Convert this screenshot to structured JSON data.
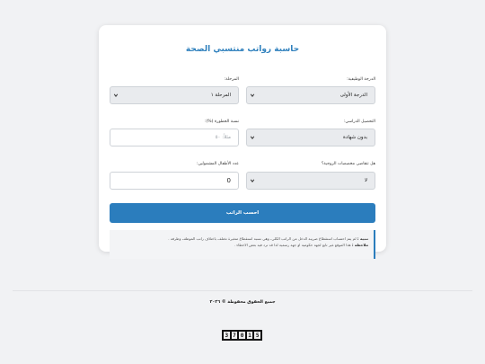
{
  "title": "حاسبة رواتب منتسبي الصحة",
  "fields": {
    "job_grade": {
      "label": "الدرجة الوظيفية:",
      "value": "الدرجة الأولى"
    },
    "stage": {
      "label": "المرحلة:",
      "value": "المرحلة ١"
    },
    "education": {
      "label": "التحصيل الدراسي:",
      "value": "بدون شهادة"
    },
    "risk_rate": {
      "label": "نسبة الخطورة (%):",
      "value": "",
      "placeholder": "مثلاً: ٥٠"
    },
    "marriage_allowance": {
      "label": "هل تتقاضى مخصصات الزوجية؟",
      "value": "لا"
    },
    "children": {
      "label": "عدد الأطفال المشمولين:",
      "value": "0"
    }
  },
  "submit_label": "احسب الراتب",
  "notes": {
    "note1_heading": "تنبيه :",
    "note1_text": "لم يتم احتساب استقطاع ضريبة الدخل من الراتب الكلي، وهي نسبة استقطاع متغيرة تختلف باختلاف راتب الموظف وظرفه .",
    "note2_heading": "ملاحظة :",
    "note2_text": "هذا الموقع غير تابع لجهة حكومية او جهة رسمية لذا قد ترد فيه بعض الاخطاء ."
  },
  "footer": "جميع الحقوق محفوظة © ٢٠٢٦",
  "counter": [
    "3",
    "7",
    "0",
    "1",
    "5"
  ],
  "colors": {
    "accent": "#2b7dbd",
    "title": "#2f80bd",
    "background": "#f1f2f4"
  },
  "icons": {
    "dropdown": "chevron-down-icon"
  }
}
